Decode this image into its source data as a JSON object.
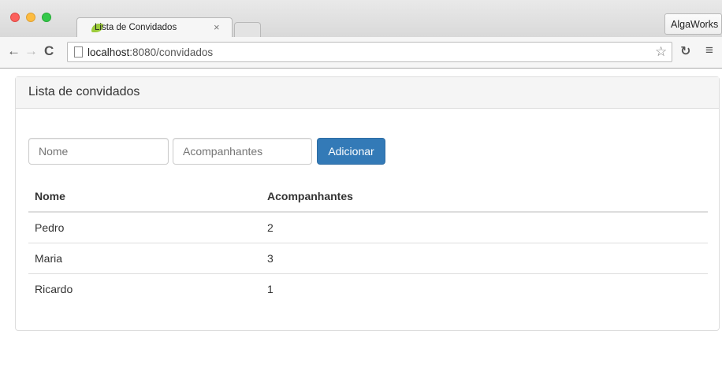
{
  "browser": {
    "tab_title": "Lista de Convidados",
    "tab_close": "×",
    "profile_label": "AlgaWorks",
    "url_host": "localhost",
    "url_rest": ":8080/convidados"
  },
  "page": {
    "panel_title": "Lista de convidados",
    "form": {
      "name_placeholder": "Nome",
      "companions_placeholder": "Acompanhantes",
      "add_label": "Adicionar"
    },
    "table": {
      "headers": [
        "Nome",
        "Acompanhantes"
      ],
      "rows": [
        [
          "Pedro",
          "2"
        ],
        [
          "Maria",
          "3"
        ],
        [
          "Ricardo",
          "1"
        ]
      ]
    }
  },
  "icons": {
    "back": "back-arrow-icon",
    "forward": "forward-arrow-icon",
    "reload": "reload-icon",
    "page": "page-icon",
    "star": "star-icon",
    "extension": "extension-icon",
    "menu": "menu-icon",
    "favicon": "leaf-favicon-icon"
  },
  "colors": {
    "primary_button": "#337ab7",
    "panel_heading_bg": "#f5f5f5"
  }
}
